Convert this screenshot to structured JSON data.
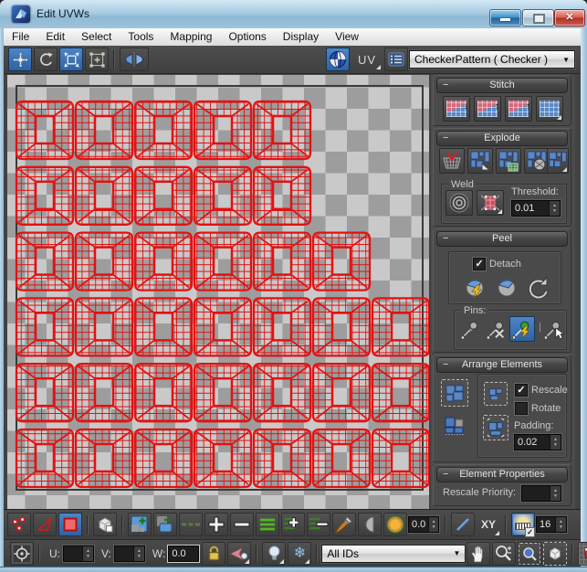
{
  "window": {
    "title": "Edit UVWs"
  },
  "menu": {
    "items": [
      "File",
      "Edit",
      "Select",
      "Tools",
      "Mapping",
      "Options",
      "Display",
      "View"
    ]
  },
  "top_toolbar": {
    "uv_label": "UV",
    "texture_selector": "CheckerPattern  ( Checker )"
  },
  "icons": {
    "collapse": "−",
    "dropdown_arrow": "▼",
    "spinner_up": "▲",
    "spinner_down": "▼",
    "check": "✓",
    "stitch_arrow_down": "↓",
    "stitch_arrow_updown": "↕",
    "stitch_arrow_up": "↑",
    "snowflake": "❄",
    "pins_separator": "|"
  },
  "canvas": {
    "checker_light": "#c9c9c9",
    "checker_dark": "#9d9d9d",
    "wire_color": "#e31111",
    "island_rows": [
      5,
      5,
      6,
      7,
      7,
      7
    ]
  },
  "panel": {
    "stitch": {
      "title": "Stitch"
    },
    "explode": {
      "title": "Explode",
      "weld": {
        "title": "Weld",
        "threshold_label": "Threshold:",
        "threshold_value": "0.01"
      }
    },
    "peel": {
      "title": "Peel",
      "detach_label": "Detach",
      "detach_checked": true,
      "pins_label": "Pins:"
    },
    "arrange": {
      "title": "Arrange Elements",
      "rescale_label": "Rescale",
      "rescale_checked": true,
      "rotate_label": "Rotate",
      "rotate_checked": false,
      "padding_label": "Padding:",
      "padding_value": "0.02"
    },
    "element_properties": {
      "title": "Element Properties",
      "rescale_priority_label": "Rescale Priority:",
      "rescale_priority_value": ""
    }
  },
  "bottom_row1": {
    "items": [
      {
        "name": "vertex-mode-button",
        "icon": "vertex-icon"
      },
      {
        "name": "edge-mode-button",
        "icon": "edge-icon"
      },
      {
        "name": "polygon-mode-button",
        "icon": "polygon-icon",
        "active": true
      },
      {
        "sep": true
      },
      {
        "name": "element-mode-button",
        "icon": "cube-icon"
      },
      {
        "sep": true
      },
      {
        "name": "grow-selection-button",
        "icon": "grow-icon"
      },
      {
        "name": "shrink-selection-button",
        "icon": "shrink-icon"
      },
      {
        "name": "edge-loop-button",
        "icon": "loop-dim-icon"
      },
      {
        "name": "grow-loop-button",
        "icon": "plus-icon"
      },
      {
        "name": "shrink-loop-button",
        "icon": "minus-icon"
      },
      {
        "name": "edge-ring-button",
        "icon": "ring-icon"
      },
      {
        "name": "grow-ring-button",
        "icon": "ring-plus-icon"
      },
      {
        "name": "shrink-ring-button",
        "icon": "ring-minus-icon"
      },
      {
        "name": "paint-select-button",
        "icon": "brush-icon"
      },
      {
        "name": "paint-falloff-button",
        "icon": "half-circle-icon"
      },
      {
        "name": "soft-selection-falloff-button",
        "icon": "falloff-icon"
      },
      {
        "name": "falloff-value-field",
        "field": "0.0",
        "spin": true
      },
      {
        "sep": true
      },
      {
        "name": "edge-distance-button",
        "icon": "blue-line-icon"
      },
      {
        "name": "axis-space-button",
        "btnText": "XY",
        "fly": true
      },
      {
        "sep": true
      },
      {
        "name": "grid-visibility-toggle",
        "icon": "ruler-grid-icon",
        "active": true
      },
      {
        "name": "grid-size-field",
        "field": "16",
        "spin": true
      }
    ]
  },
  "bottom_row2": {
    "items": [
      {
        "name": "absolute-offset-button",
        "icon": "abs-icon"
      },
      {
        "sep": true
      },
      {
        "label": "U:",
        "name": "u-label"
      },
      {
        "name": "u-field",
        "field": "",
        "spin": true
      },
      {
        "label": "V:",
        "name": "v-label"
      },
      {
        "name": "v-field",
        "field": "",
        "spin": true
      },
      {
        "label": "W:",
        "name": "w-label"
      },
      {
        "name": "w-field",
        "field": "0.0",
        "wfield": true
      },
      {
        "name": "lock-selection-button",
        "icon": "lock-icon"
      },
      {
        "name": "gizmo-preview-button",
        "icon": "gizmo-arrow-icon",
        "fly": true
      },
      {
        "sep": true
      },
      {
        "name": "show-hidden-button",
        "icon": "bulb-icon",
        "fly": true
      },
      {
        "name": "freeze-button",
        "icon": "snowflake-icon",
        "fly": true
      },
      {
        "sep": true
      },
      {
        "name": "material-id-filter",
        "dropdown": "All IDs"
      },
      {
        "name": "pan-button",
        "icon": "hand-icon"
      },
      {
        "name": "zoom-button",
        "icon": "zoom-icon"
      },
      {
        "name": "zoom-region-button",
        "icon": "zoom-region-icon"
      },
      {
        "name": "zoom-extents-button",
        "icon": "zoom-extents-icon"
      },
      {
        "sep": true
      },
      {
        "name": "snap-toggle-button",
        "icon": "magnet-icon"
      }
    ]
  }
}
